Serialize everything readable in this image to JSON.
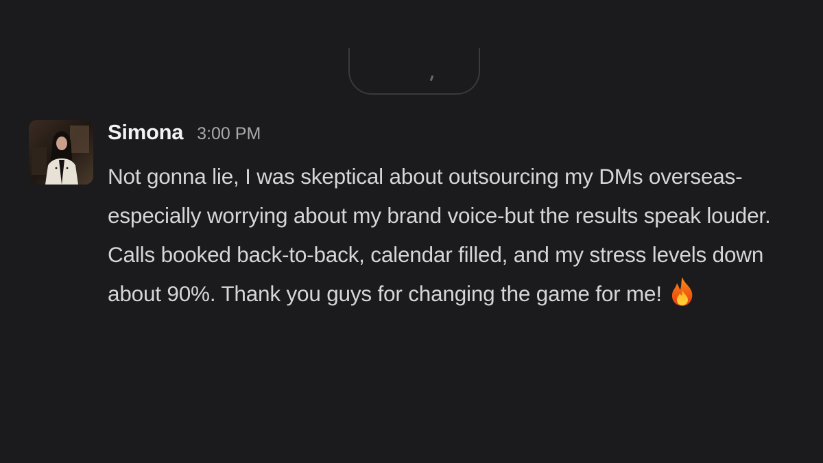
{
  "message": {
    "author": "Simona",
    "timestamp": "3:00 PM",
    "avatar_icon": "user-avatar-photo",
    "text": "Not gonna lie, I was skeptical about outsourcing my DMs overseas-especially worrying about my brand voice-but the results speak louder. Calls booked back-to-back, calendar filled, and my stress levels down about 90%. Thank you guys for changing the game for me!",
    "emoji": "fire-emoji"
  },
  "colors": {
    "background": "#1b1b1e",
    "author": "#f2f2f2",
    "timestamp": "#a9a9ad",
    "body_text": "#d6d6d8",
    "divider": "#3a3a3e"
  }
}
